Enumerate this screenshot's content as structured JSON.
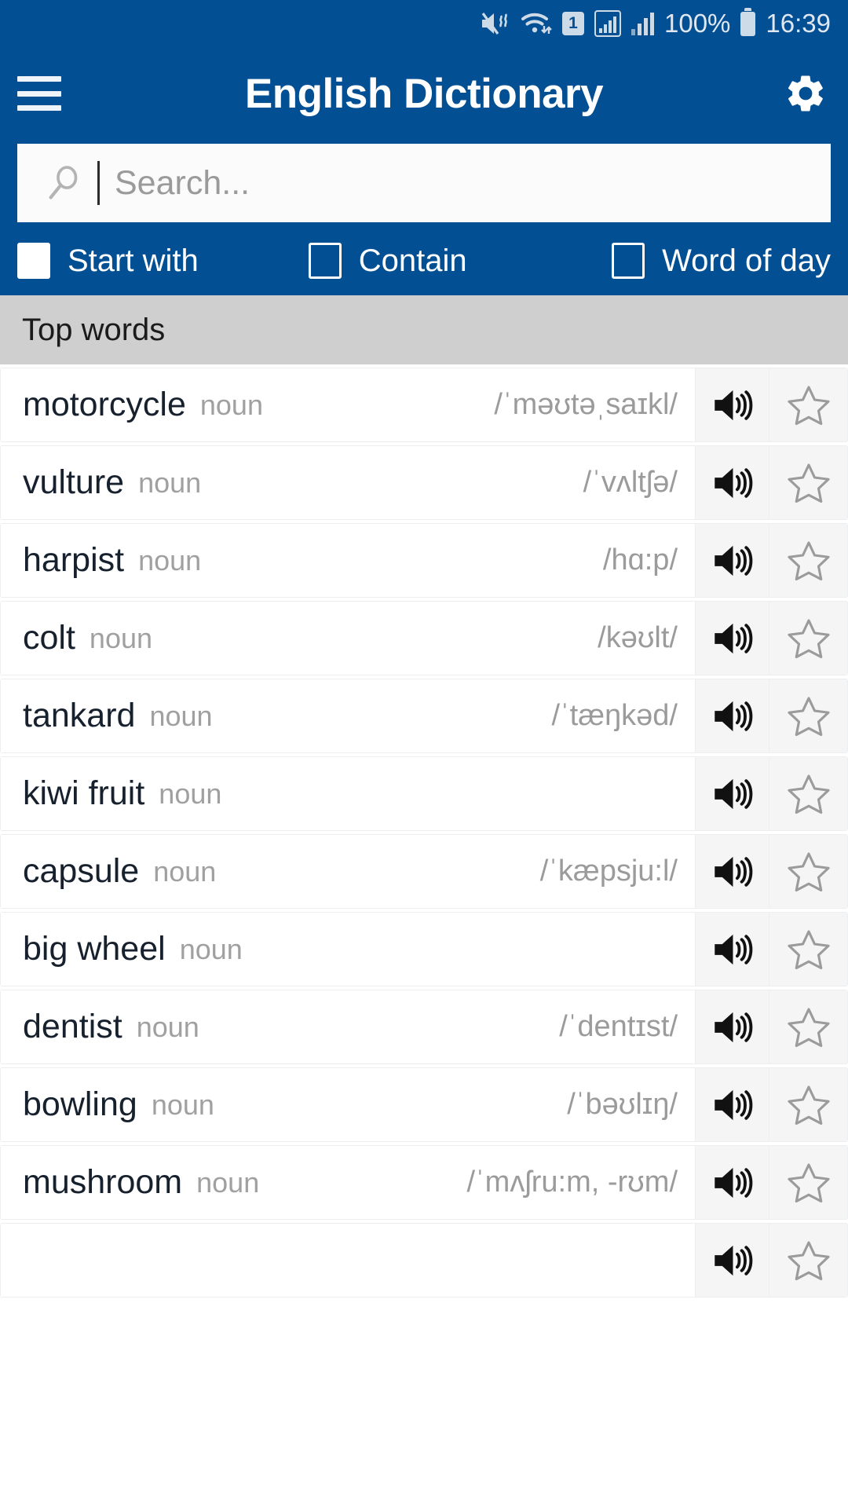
{
  "statusbar": {
    "icons": [
      "mute-icon",
      "wifi-icon",
      "sim-1-icon",
      "signal-boxed-icon",
      "signal-icon"
    ],
    "sim_label": "1",
    "battery_percent": "100%",
    "time": "16:39"
  },
  "appbar": {
    "menu_icon": "hamburger-menu-icon",
    "title": "English Dictionary",
    "settings_icon": "gear-icon"
  },
  "search": {
    "icon": "search-icon",
    "placeholder": "Search...",
    "value": ""
  },
  "filters": [
    {
      "label": "Start with",
      "checked": true
    },
    {
      "label": "Contain",
      "checked": false
    },
    {
      "label": "Word of day",
      "checked": false
    }
  ],
  "section": {
    "title": "Top words"
  },
  "colors": {
    "brand_blue": "#024f93",
    "section_gray": "#cfcfcf",
    "word_text": "#17212e",
    "muted_text": "#9b9b9b",
    "icon_cell_bg": "#f5f5f6"
  },
  "list": {
    "speaker_icon": "speaker-icon",
    "star_icon": "star-outline-icon",
    "rows": [
      {
        "word": "motorcycle",
        "pos": "noun",
        "ipa": "/ˈməʊtəˌsaɪkl/"
      },
      {
        "word": "vulture",
        "pos": "noun",
        "ipa": "/ˈvʌltʃə/"
      },
      {
        "word": "harpist",
        "pos": "noun",
        "ipa": "/hɑ:p/"
      },
      {
        "word": "colt",
        "pos": "noun",
        "ipa": "/kəʊlt/"
      },
      {
        "word": "tankard",
        "pos": "noun",
        "ipa": "/ˈtæŋkəd/"
      },
      {
        "word": "kiwi fruit",
        "pos": "noun",
        "ipa": ""
      },
      {
        "word": "capsule",
        "pos": "noun",
        "ipa": "/ˈkæpsju:l/"
      },
      {
        "word": "big wheel",
        "pos": "noun",
        "ipa": ""
      },
      {
        "word": "dentist",
        "pos": "noun",
        "ipa": "/ˈdentɪst/"
      },
      {
        "word": "bowling",
        "pos": "noun",
        "ipa": "/ˈbəʊlɪŋ/"
      },
      {
        "word": "mushroom",
        "pos": "noun",
        "ipa": "/ˈmʌʃru:m, -rʊm/"
      },
      {
        "word": "",
        "pos": "",
        "ipa": ""
      }
    ]
  }
}
